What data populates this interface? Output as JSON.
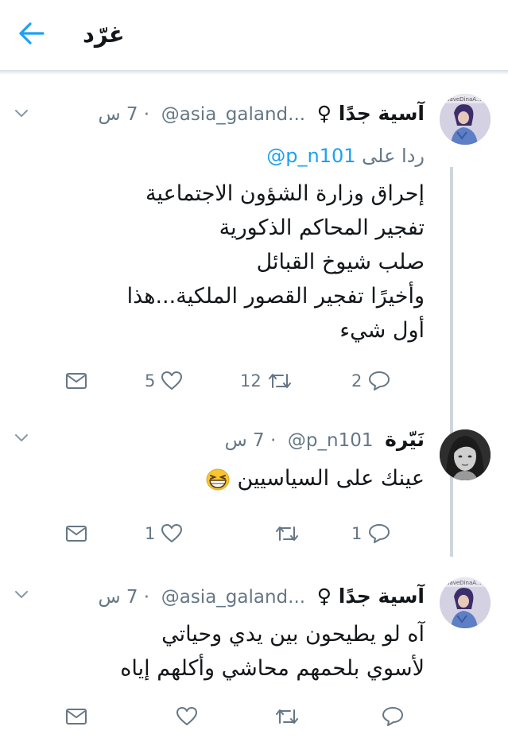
{
  "header": {
    "title": "غرّد"
  },
  "tweets": [
    {
      "name": "آسية جدًا ♀",
      "handle": "@asia_galand...",
      "time": "· 7 س",
      "reply_prefix": "ردا على",
      "reply_to": "@p_n101",
      "lines": [
        "إحراق وزارة الشؤون الاجتماعية",
        "تفجير المحاكم الذكورية",
        "صلب شيوخ القبائل",
        "وأخيرًا تفجير القصور الملكية...هذا",
        "أول شيء"
      ],
      "avatar_text": "SaveDinaA...",
      "replies": "2",
      "retweets": "12",
      "likes": "5"
    },
    {
      "name": "نَيّرة",
      "handle": "@p_n101",
      "time": "· 7 س",
      "lines": [
        "عينك على السياسيين"
      ],
      "replies": "1",
      "retweets": "",
      "likes": "1"
    },
    {
      "name": "آسية جدًا ♀",
      "handle": "@asia_galand...",
      "time": "· 7 س",
      "lines": [
        "آه لو يطيحون بين يدي وحياتي",
        "لأسوي بلحمهم محاشي وأكلهم إياه"
      ],
      "avatar_text": "SaveDinaA...",
      "replies": "",
      "retweets": "",
      "likes": ""
    }
  ],
  "colors": {
    "accent": "#1da1f2",
    "muted": "#657786",
    "text": "#14171a",
    "thread": "#cdd6dd"
  },
  "icons": [
    "back-arrow-icon",
    "chevron-down-icon",
    "reply-icon",
    "retweet-icon",
    "like-icon",
    "dm-icon",
    "grinning-emoji-icon"
  ]
}
